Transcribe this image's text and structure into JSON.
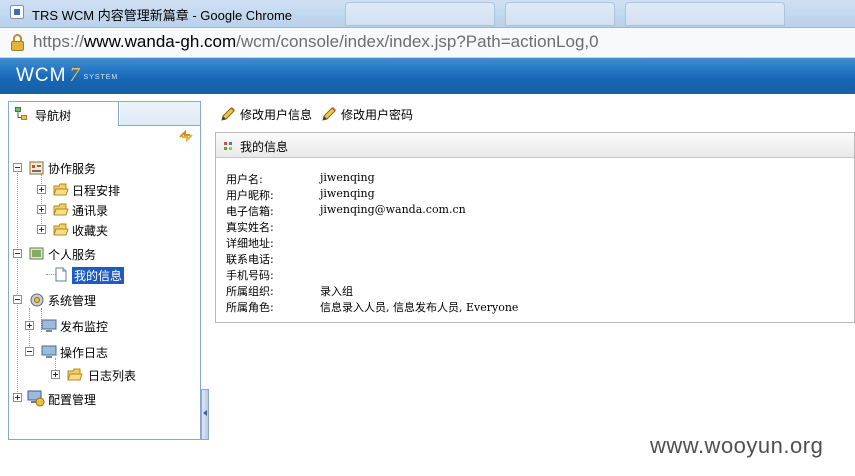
{
  "browser": {
    "window_title": "TRS WCM 内容管理新篇章 - Google Chrome",
    "url_scheme": "https://",
    "url_host": "www.wanda-gh.com",
    "url_rest": "/wcm/console/index/index.jsp?Path=actionLog,0"
  },
  "header": {
    "logo_text": "WCM",
    "logo_version": "7",
    "logo_suffix": "SYSTEM"
  },
  "nav": {
    "tab_label": "导航树",
    "tree": [
      {
        "label": "协作服务",
        "expanded": true,
        "icon": "collaboration-icon"
      },
      {
        "label": "日程安排",
        "expanded": false,
        "icon": "folder-icon"
      },
      {
        "label": "通讯录",
        "expanded": false,
        "icon": "folder-icon"
      },
      {
        "label": "收藏夹",
        "expanded": false,
        "icon": "folder-icon"
      },
      {
        "label": "个人服务",
        "expanded": true,
        "icon": "personal-service-icon"
      },
      {
        "label": "我的信息",
        "selected": true,
        "icon": "document-icon"
      },
      {
        "label": "系统管理",
        "expanded": true,
        "icon": "system-management-icon"
      },
      {
        "label": "发布监控",
        "expanded": false,
        "icon": "monitor-icon"
      },
      {
        "label": "操作日志",
        "expanded": true,
        "icon": "monitor-icon"
      },
      {
        "label": "日志列表",
        "expanded": false,
        "icon": "folder-icon"
      },
      {
        "label": "配置管理",
        "expanded": false,
        "icon": "config-icon"
      }
    ]
  },
  "toolbar": {
    "edit_info_label": "修改用户信息",
    "edit_password_label": "修改用户密码"
  },
  "panel": {
    "title": "我的信息",
    "fields": [
      {
        "label": "用户名:",
        "value": "jiwenqing"
      },
      {
        "label": "用户昵称:",
        "value": "jiwenqing"
      },
      {
        "label": "电子信箱:",
        "value": "jiwenqing@wanda.com.cn"
      },
      {
        "label": "真实姓名:",
        "value": ""
      },
      {
        "label": "详细地址:",
        "value": ""
      },
      {
        "label": "联系电话:",
        "value": ""
      },
      {
        "label": "手机号码:",
        "value": ""
      },
      {
        "label": "所属组织:",
        "value": "录入组"
      },
      {
        "label": "所属角色:",
        "value": "信息录入人员, 信息发布人员, Everyone"
      }
    ]
  },
  "watermark": "www.wooyun.org",
  "colors": {
    "header_blue": "#1666b5",
    "selection_blue": "#1e5bbf",
    "logo_accent": "#f2c54a"
  }
}
